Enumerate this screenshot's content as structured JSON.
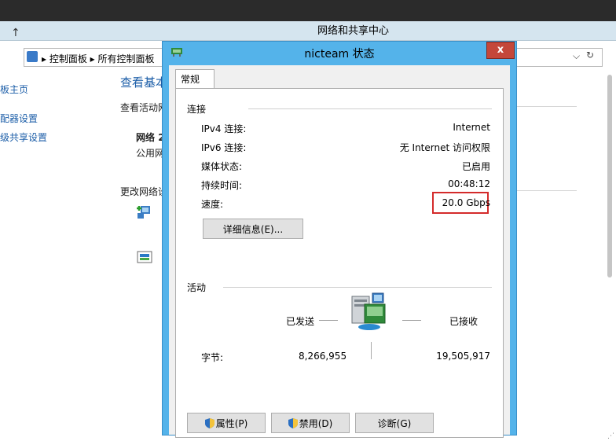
{
  "background_window": {
    "title": "网络和共享中心",
    "breadcrumb": {
      "root": "控制面板",
      "child": "所有控制面板"
    },
    "sidebar": [
      {
        "label": "板主页"
      },
      {
        "label": "配器设置"
      },
      {
        "label": "级共享设置"
      }
    ],
    "main": {
      "heading": "查看基本",
      "active_label": "查看活动网",
      "network_name": "网络",
      "network_suffix": "2",
      "network_type": "公用网",
      "change_settings": "更改网络设"
    }
  },
  "dialog": {
    "title": "nicteam 状态",
    "close": "x",
    "tab_label": "常规",
    "connection": {
      "section_label": "连接",
      "rows": [
        {
          "label": "IPv4 连接:",
          "value": "Internet"
        },
        {
          "label": "IPv6 连接:",
          "value": "无 Internet 访问权限"
        },
        {
          "label": "媒体状态:",
          "value": "已启用"
        },
        {
          "label": "持续时间:",
          "value": "00:48:12"
        },
        {
          "label": "速度:",
          "value": "20.0 Gbps"
        }
      ],
      "details_button": "详细信息(E)..."
    },
    "activity": {
      "section_label": "活动",
      "sent_label": "已发送",
      "received_label": "已接收",
      "bytes_label": "字节:",
      "bytes_sent": "8,266,955",
      "bytes_received": "19,505,917"
    },
    "buttons": {
      "properties": "属性(P)",
      "disable": "禁用(D)",
      "diagnose": "诊断(G)"
    }
  },
  "colors": {
    "dialog_frame": "#54b3ea",
    "close_button": "#c4473a",
    "speed_highlight": "#d42b2b",
    "link": "#1c5ea8"
  }
}
